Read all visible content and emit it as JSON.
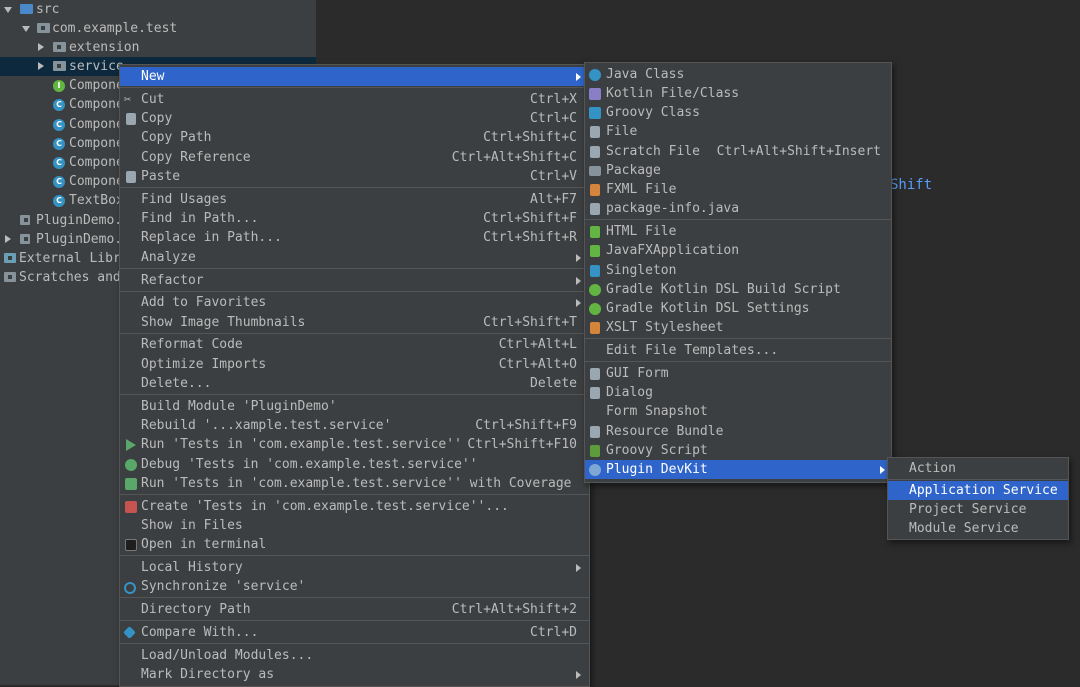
{
  "tree": {
    "src": "src",
    "pkg": "com.example.test",
    "extension": "extension",
    "service": "service",
    "items": [
      "Compone",
      "Compone",
      "Compone",
      "Compone",
      "Compone",
      "Compone",
      "TextBox"
    ],
    "plugin1": "PluginDemo.",
    "plugin2": "PluginDemo.",
    "external": "External Libra",
    "scratches": "Scratches and"
  },
  "editor_bg_text": "Shift",
  "context_menu": {
    "new": "New",
    "cut": "Cut",
    "cut_sc": "Ctrl+X",
    "copy": "Copy",
    "copy_sc": "Ctrl+C",
    "copy_path": "Copy Path",
    "copy_path_sc": "Ctrl+Shift+C",
    "copy_ref": "Copy Reference",
    "copy_ref_sc": "Ctrl+Alt+Shift+C",
    "paste": "Paste",
    "paste_sc": "Ctrl+V",
    "find_usages": "Find Usages",
    "find_usages_sc": "Alt+F7",
    "find_in_path": "Find in Path...",
    "find_in_path_sc": "Ctrl+Shift+F",
    "replace_in_path": "Replace in Path...",
    "replace_in_path_sc": "Ctrl+Shift+R",
    "analyze": "Analyze",
    "refactor": "Refactor",
    "add_fav": "Add to Favorites",
    "thumbs": "Show Image Thumbnails",
    "thumbs_sc": "Ctrl+Shift+T",
    "reformat": "Reformat Code",
    "reformat_sc": "Ctrl+Alt+L",
    "optimize": "Optimize Imports",
    "optimize_sc": "Ctrl+Alt+O",
    "delete": "Delete...",
    "delete_sc": "Delete",
    "build": "Build Module 'PluginDemo'",
    "rebuild": "Rebuild '...xample.test.service'",
    "rebuild_sc": "Ctrl+Shift+F9",
    "run_tests": "Run 'Tests in 'com.example.test.service''",
    "run_tests_sc": "Ctrl+Shift+F10",
    "debug_tests": "Debug 'Tests in 'com.example.test.service''",
    "run_cov": "Run 'Tests in 'com.example.test.service'' with Coverage",
    "create_tests": "Create 'Tests in 'com.example.test.service''...",
    "show_files": "Show in Files",
    "open_term": "Open in terminal",
    "local_history": "Local History",
    "sync": "Synchronize 'service'",
    "dir_path": "Directory Path",
    "dir_path_sc": "Ctrl+Alt+Shift+2",
    "compare": "Compare With...",
    "compare_sc": "Ctrl+D",
    "load_unload": "Load/Unload Modules...",
    "mark_dir": "Mark Directory as"
  },
  "new_menu": {
    "java_class": "Java Class",
    "kotlin": "Kotlin File/Class",
    "groovy_class": "Groovy Class",
    "file": "File",
    "scratch": "Scratch File",
    "scratch_sc": "Ctrl+Alt+Shift+Insert",
    "package": "Package",
    "fxml": "FXML File",
    "pkg_info": "package-info.java",
    "html": "HTML File",
    "javafx": "JavaFXApplication",
    "singleton": "Singleton",
    "gradle_build": "Gradle Kotlin DSL Build Script",
    "gradle_settings": "Gradle Kotlin DSL Settings",
    "xslt": "XSLT Stylesheet",
    "edit_templates": "Edit File Templates...",
    "gui_form": "GUI Form",
    "dialog": "Dialog",
    "form_snapshot": "Form Snapshot",
    "resource_bundle": "Resource Bundle",
    "groovy_script": "Groovy Script",
    "plugin_devkit": "Plugin DevKit"
  },
  "devkit_menu": {
    "action": "Action",
    "app_service": "Application Service",
    "project_service": "Project Service",
    "module_service": "Module Service"
  },
  "colors": {
    "highlight": "#2f65ca",
    "menu_bg": "#3c3f41",
    "tree_selection": "#0d293e"
  }
}
